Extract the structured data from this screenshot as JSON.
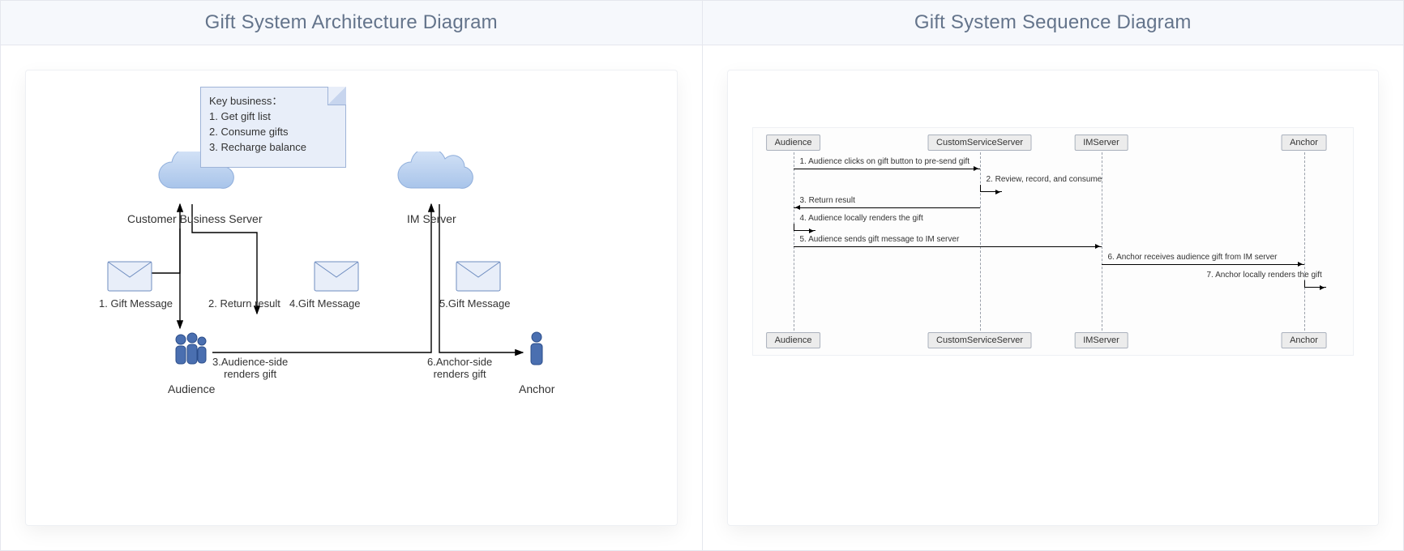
{
  "left": {
    "title": "Gift System Architecture Diagram",
    "note": {
      "heading": "Key business：",
      "items": [
        "1. Get gift list",
        "2. Consume gifts",
        "3. Recharge balance"
      ]
    },
    "clouds": {
      "business_server": "Customer Business Server",
      "im_server": "IM Server"
    },
    "envelopes": {
      "e1": "1. Gift Message",
      "e4": "4.Gift Message",
      "e5": "5.Gift Message"
    },
    "steps": {
      "s2": "2. Return result",
      "s3": "3.Audience-side\nrenders gift",
      "s6": "6.Anchor-side\nrenders gift"
    },
    "actors": {
      "audience": "Audience",
      "anchor": "Anchor"
    }
  },
  "right": {
    "title": "Gift System Sequence Diagram",
    "lanes": [
      "Audience",
      "CustomServiceServer",
      "IMServer",
      "Anchor"
    ],
    "messages": [
      {
        "n": 1,
        "text": "1. Audience clicks on gift button to pre-send gift",
        "from": 0,
        "to": 1
      },
      {
        "n": 2,
        "text": "2. Review, record, and consume",
        "from": 1,
        "to": 1
      },
      {
        "n": 3,
        "text": "3. Return result",
        "from": 1,
        "to": 0
      },
      {
        "n": 4,
        "text": "4. Audience locally renders the gift",
        "from": 0,
        "to": 0
      },
      {
        "n": 5,
        "text": "5. Audience sends gift message to IM server",
        "from": 0,
        "to": 2
      },
      {
        "n": 6,
        "text": "6. Anchor receives audience gift from IM server",
        "from": 2,
        "to": 3
      },
      {
        "n": 7,
        "text": "7. Anchor locally renders the gift",
        "from": 3,
        "to": 3
      }
    ]
  }
}
